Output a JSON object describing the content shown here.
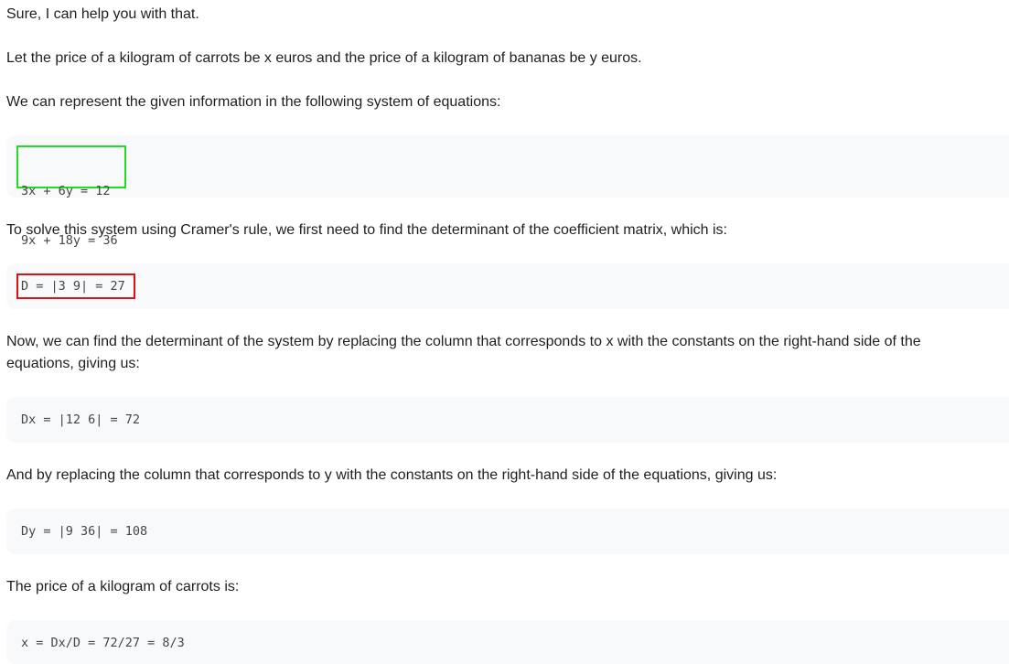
{
  "response": {
    "intro": "Sure, I can help you with that.",
    "let_statement": "Let the price of a kilogram of carrots be x euros and the price of a kilogram of bananas be y euros.",
    "represent": "We can represent the given information in the following system of equations:",
    "system_lines": [
      "3x + 6y = 12",
      "9x + 18y = 36"
    ],
    "cramer_intro": "To solve this system using Cramer's rule, we first need to find the determinant of the coefficient matrix, which is:",
    "determinant": "D = |3 9| = 27",
    "replace_x": "Now, we can find the determinant of the system by replacing the column that corresponds to x with the constants on the right-hand side of the equations, giving us:",
    "dx": "Dx = |12 6| = 72",
    "replace_y": "And by replacing the column that corresponds to y with the constants on the right-hand side of the equations, giving us:",
    "dy": "Dy = |9 36| = 108",
    "carrots_price": "The price of a kilogram of carrots is:",
    "x_result": "x = Dx/D = 72/27 = 8/3"
  },
  "highlights": {
    "system_box_color": "#22dd22",
    "determinant_box_color": "#dd1111"
  }
}
